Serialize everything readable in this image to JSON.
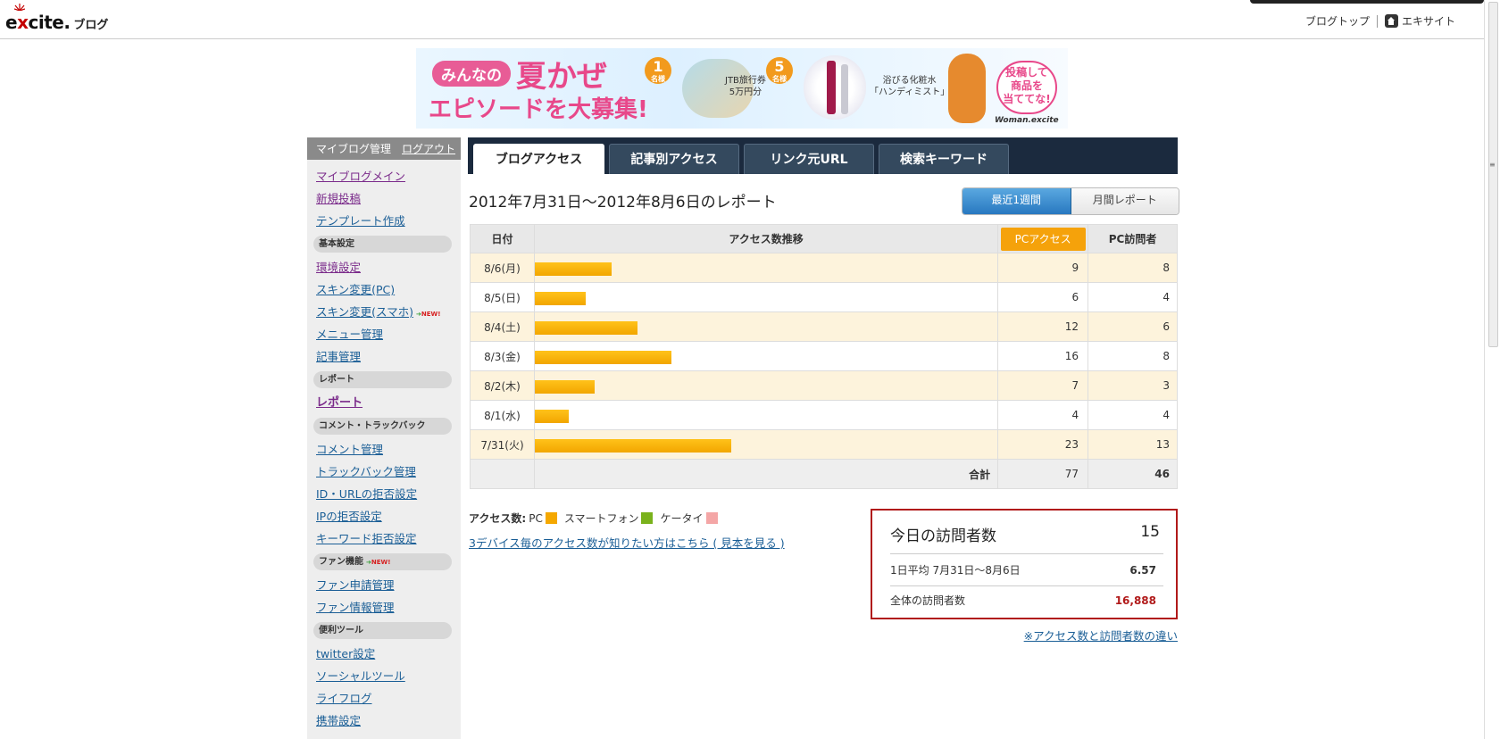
{
  "header": {
    "logo_brand_pre": "e",
    "logo_brand_x": "x",
    "logo_brand_post": "cite.",
    "logo_product": "ブログ",
    "link_blog_top": "ブログトップ",
    "link_excite_site": "エキサイト"
  },
  "banner": {
    "pill": "みんなの",
    "headline": "夏かぜ",
    "subline": "エピソードを大募集!",
    "prize1_count": "1",
    "prize1_unit": "名様",
    "prize1_text_a": "JTB旅行券",
    "prize1_text_b": "5万円分",
    "prize2_count": "5",
    "prize2_unit": "名様",
    "prize2_text_a": "浴びる化粧水",
    "prize2_text_b": "「ハンディミスト」",
    "bubble_a": "投稿して",
    "bubble_b": "商品を",
    "bubble_c": "当ててな!",
    "brand": "Woman.excite"
  },
  "sidebar": {
    "title": "マイブログ管理",
    "logout": "ログアウト",
    "items": {
      "my_blog_main": "マイブログメイン",
      "new_post": "新規投稿",
      "template": "テンプレート作成",
      "cat_basic": "基本設定",
      "env": "環境設定",
      "skin_pc": "スキン変更(PC)",
      "skin_sp": "スキン変更(スマホ)",
      "menu": "メニュー管理",
      "article": "記事管理",
      "cat_report": "レポート",
      "report": "レポート",
      "cat_comment": "コメント・トラックバック",
      "comment": "コメント管理",
      "trackback": "トラックバック管理",
      "id_url_reject": "ID・URLの拒否設定",
      "ip_reject": "IPの拒否設定",
      "keyword_reject": "キーワード拒否設定",
      "cat_fan": "ファン機能",
      "fan_request": "ファン申請管理",
      "fan_info": "ファン情報管理",
      "cat_tools": "便利ツール",
      "twitter": "twitter設定",
      "social": "ソーシャルツール",
      "lifelog": "ライフログ",
      "mobile": "携帯設定"
    },
    "new_mark": "NEW!",
    "new_arrow": "➔"
  },
  "tabs": [
    "ブログアクセス",
    "記事別アクセス",
    "リンク元URL",
    "検索キーワード"
  ],
  "report": {
    "title": "2012年7月31日〜2012年8月6日のレポート",
    "toggle_week": "最近1週間",
    "toggle_month": "月間レポート"
  },
  "table": {
    "headers": [
      "日付",
      "アクセス数推移",
      "PCアクセス",
      "PC訪問者"
    ],
    "max_access": 23,
    "rows": [
      {
        "date": "8/6(月)",
        "access": "9",
        "visitors": "8"
      },
      {
        "date": "8/5(日)",
        "access": "6",
        "visitors": "4"
      },
      {
        "date": "8/4(土)",
        "access": "12",
        "visitors": "6"
      },
      {
        "date": "8/3(金)",
        "access": "16",
        "visitors": "8"
      },
      {
        "date": "8/2(木)",
        "access": "7",
        "visitors": "3"
      },
      {
        "date": "8/1(水)",
        "access": "4",
        "visitors": "4"
      },
      {
        "date": "7/31(火)",
        "access": "23",
        "visitors": "13"
      }
    ],
    "total_label": "合計",
    "total_access": "77",
    "total_visitors": "46"
  },
  "legend": {
    "label": "アクセス数:",
    "pc": "PC",
    "smartphone": "スマートフォン",
    "keitai": "ケータイ",
    "colors": {
      "pc": "#f5a800",
      "smartphone": "#7ab21c",
      "keitai": "#f4a6a6"
    }
  },
  "device_link": "3デバイス毎のアクセス数が知りたい方はこちら ( 見本を見る )",
  "visitors": {
    "today_label": "今日の訪問者数",
    "today_value": "15",
    "avg_label": "1日平均 7月31日〜8月6日",
    "avg_value": "6.57",
    "total_label": "全体の訪問者数",
    "total_value": "16,888"
  },
  "diff_link": "※アクセス数と訪問者数の違い"
}
